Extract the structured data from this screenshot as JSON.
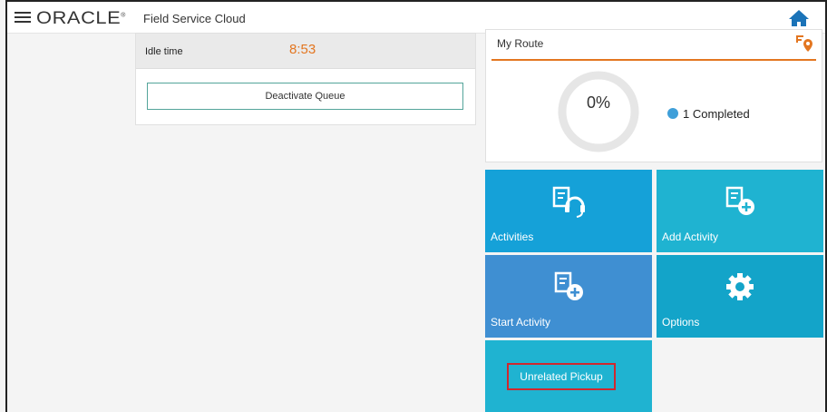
{
  "header": {
    "brand": "ORACLE",
    "app_title": "Field Service Cloud"
  },
  "queue": {
    "idle_label": "Idle time",
    "idle_value": "8:53",
    "deactivate_label": "Deactivate Queue"
  },
  "route": {
    "title": "My Route",
    "progress_text": "0%",
    "progress_fraction": 0,
    "completed_label": "1 Completed"
  },
  "tiles": {
    "activities": "Activities",
    "add_activity": "Add Activity",
    "start_activity": "Start Activity",
    "options": "Options",
    "unrelated_pickup": "Unrelated Pickup"
  },
  "colors": {
    "accent_orange": "#e37620",
    "completed_blue": "#3f9fd9",
    "highlight_red": "#d0282e"
  }
}
